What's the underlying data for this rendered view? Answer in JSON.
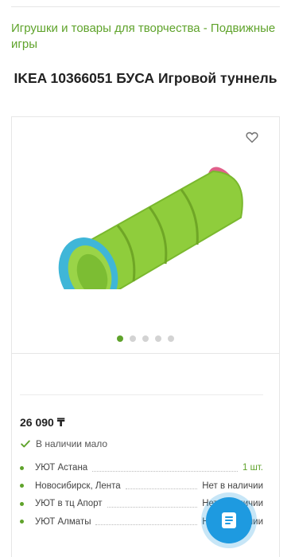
{
  "breadcrumb": {
    "text": "Игрушки и товары для творчества - Подвижные игры"
  },
  "product": {
    "title": "IKEA 10366051 БУСА Игровой туннель",
    "price": "26 090 ₸",
    "availability": "В наличии мало"
  },
  "gallery": {
    "slide_count": 5,
    "active_index": 0,
    "image_alt": "green-play-tunnel"
  },
  "stores": [
    {
      "name": "УЮТ Астана",
      "status": "1 шт.",
      "in_stock": true
    },
    {
      "name": "Новосибирск, Лента",
      "status": "Нет в наличии",
      "in_stock": false
    },
    {
      "name": "УЮТ в тц Апорт",
      "status": "Нет в наличии",
      "in_stock": false
    },
    {
      "name": "УЮТ Алматы",
      "status": "Нет в наличии",
      "in_stock": false
    }
  ],
  "icons": {
    "favorite": "heart-icon",
    "availability": "check-icon",
    "fab": "document-icon"
  },
  "colors": {
    "accent_green": "#5fa32b",
    "fab_blue": "#1e9ae0",
    "tunnel_green": "#8fcd3c",
    "tunnel_ring_blue": "#3fb6d8",
    "tunnel_ring_pink": "#e0608a"
  }
}
